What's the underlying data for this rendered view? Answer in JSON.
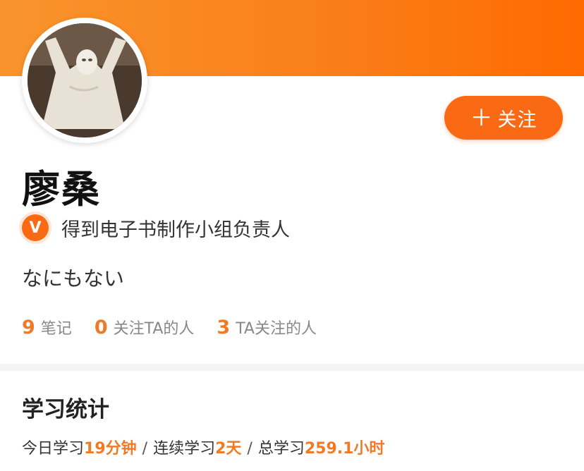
{
  "header": {
    "banner_color": "#fa7d17"
  },
  "profile": {
    "name": "廖桑",
    "verification_icon_letter": "V",
    "verification_title": "得到电子书制作小组负责人",
    "bio": "なにもない",
    "follow_button_label": "+ 关注",
    "follow_label": "关注"
  },
  "stats": [
    {
      "value": "9",
      "label": "笔记"
    },
    {
      "value": "0",
      "label": "关注TA的人"
    },
    {
      "value": "3",
      "label": "TA关注的人"
    }
  ],
  "study_stats": {
    "section_title": "学习统计",
    "today_label": "今日学习",
    "today_value": "19分钟",
    "streak_label": "连续学习",
    "streak_value": "2天",
    "total_label": "总学习",
    "total_value": "259.1小时",
    "separator": "/"
  },
  "colors": {
    "accent": "#fa6a14",
    "stat_number": "#f07a28"
  },
  "icons": {
    "plus": "plus-icon",
    "verify": "verified-v-badge-icon"
  }
}
